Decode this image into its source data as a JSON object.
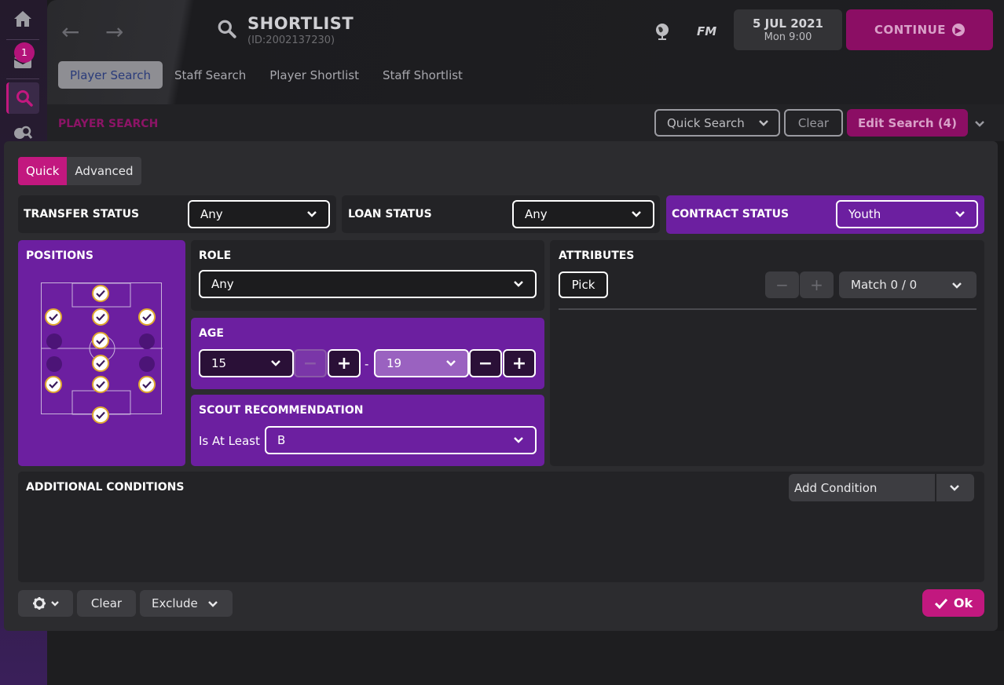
{
  "header": {
    "title": "SHORTLIST",
    "subtitle": "(ID:2002137230)",
    "fm_label": "FM",
    "date": "5 JUL 2021",
    "time": "Mon 9:00",
    "continue_label": "CONTINUE"
  },
  "rail": {
    "inbox_badge": "1"
  },
  "tabs": [
    {
      "label": "Player Search",
      "active": true
    },
    {
      "label": "Staff Search",
      "active": false
    },
    {
      "label": "Player Shortlist",
      "active": false
    },
    {
      "label": "Staff Shortlist",
      "active": false
    }
  ],
  "toolbar": {
    "section_label": "PLAYER SEARCH",
    "quick_search": "Quick Search",
    "clear": "Clear",
    "edit_search": "Edit Search (4)"
  },
  "dialog": {
    "mode_quick": "Quick",
    "mode_advanced": "Advanced",
    "transfer_status": {
      "label": "TRANSFER STATUS",
      "value": "Any"
    },
    "loan_status": {
      "label": "LOAN STATUS",
      "value": "Any"
    },
    "contract_status": {
      "label": "CONTRACT STATUS",
      "value": "Youth"
    },
    "positions": {
      "label": "POSITIONS"
    },
    "role": {
      "label": "ROLE",
      "value": "Any"
    },
    "age": {
      "label": "AGE",
      "min": "15",
      "max": "19",
      "separator": "-"
    },
    "scout": {
      "label": "SCOUT RECOMMENDATION",
      "qualifier": "Is At Least",
      "value": "B"
    },
    "attributes": {
      "label": "ATTRIBUTES",
      "pick": "Pick",
      "match": "Match 0 / 0"
    },
    "additional": {
      "label": "ADDITIONAL CONDITIONS",
      "add_condition": "Add Condition"
    },
    "footer": {
      "clear": "Clear",
      "exclude": "Exclude",
      "ok": "Ok"
    }
  },
  "colors": {
    "accent": "#c2187f",
    "purple_panel": "#6c1fa0",
    "continue": "#8b0e64"
  }
}
